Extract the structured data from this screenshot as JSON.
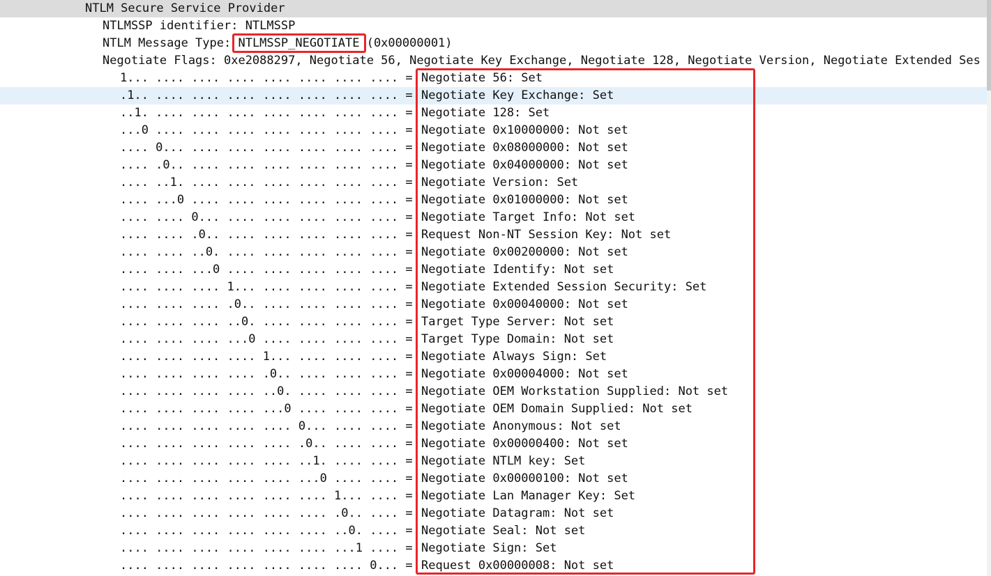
{
  "tree": {
    "ntlm_header": "NTLM Secure Service Provider",
    "identifier": "NTLMSSP identifier: NTLMSSP",
    "message_type_label": "NTLM Message Type: ",
    "message_type_value": "NTLMSSP_NEGOTIATE",
    "message_type_hex": " (0x00000001)",
    "flags_summary": "Negotiate Flags: 0xe2088297, Negotiate 56, Negotiate Key Exchange, Negotiate 128, Negotiate Version, Negotiate Extended Ses",
    "flags": [
      {
        "bits": "1... .... .... .... .... .... .... .... = ",
        "desc": "Negotiate 56: Set"
      },
      {
        "bits": ".1.. .... .... .... .... .... .... .... = ",
        "desc": "Negotiate Key Exchange: Set"
      },
      {
        "bits": "..1. .... .... .... .... .... .... .... = ",
        "desc": "Negotiate 128: Set"
      },
      {
        "bits": "...0 .... .... .... .... .... .... .... = ",
        "desc": "Negotiate 0x10000000: Not set"
      },
      {
        "bits": ".... 0... .... .... .... .... .... .... = ",
        "desc": "Negotiate 0x08000000: Not set"
      },
      {
        "bits": ".... .0.. .... .... .... .... .... .... = ",
        "desc": "Negotiate 0x04000000: Not set"
      },
      {
        "bits": ".... ..1. .... .... .... .... .... .... = ",
        "desc": "Negotiate Version: Set"
      },
      {
        "bits": ".... ...0 .... .... .... .... .... .... = ",
        "desc": "Negotiate 0x01000000: Not set"
      },
      {
        "bits": ".... .... 0... .... .... .... .... .... = ",
        "desc": "Negotiate Target Info: Not set"
      },
      {
        "bits": ".... .... .0.. .... .... .... .... .... = ",
        "desc": "Request Non-NT Session Key: Not set"
      },
      {
        "bits": ".... .... ..0. .... .... .... .... .... = ",
        "desc": "Negotiate 0x00200000: Not set"
      },
      {
        "bits": ".... .... ...0 .... .... .... .... .... = ",
        "desc": "Negotiate Identify: Not set"
      },
      {
        "bits": ".... .... .... 1... .... .... .... .... = ",
        "desc": "Negotiate Extended Session Security: Set"
      },
      {
        "bits": ".... .... .... .0.. .... .... .... .... = ",
        "desc": "Negotiate 0x00040000: Not set"
      },
      {
        "bits": ".... .... .... ..0. .... .... .... .... = ",
        "desc": "Target Type Server: Not set"
      },
      {
        "bits": ".... .... .... ...0 .... .... .... .... = ",
        "desc": "Target Type Domain: Not set"
      },
      {
        "bits": ".... .... .... .... 1... .... .... .... = ",
        "desc": "Negotiate Always Sign: Set"
      },
      {
        "bits": ".... .... .... .... .0.. .... .... .... = ",
        "desc": "Negotiate 0x00004000: Not set"
      },
      {
        "bits": ".... .... .... .... ..0. .... .... .... = ",
        "desc": "Negotiate OEM Workstation Supplied: Not set"
      },
      {
        "bits": ".... .... .... .... ...0 .... .... .... = ",
        "desc": "Negotiate OEM Domain Supplied: Not set"
      },
      {
        "bits": ".... .... .... .... .... 0... .... .... = ",
        "desc": "Negotiate Anonymous: Not set"
      },
      {
        "bits": ".... .... .... .... .... .0.. .... .... = ",
        "desc": "Negotiate 0x00000400: Not set"
      },
      {
        "bits": ".... .... .... .... .... ..1. .... .... = ",
        "desc": "Negotiate NTLM key: Set"
      },
      {
        "bits": ".... .... .... .... .... ...0 .... .... = ",
        "desc": "Negotiate 0x00000100: Not set"
      },
      {
        "bits": ".... .... .... .... .... .... 1... .... = ",
        "desc": "Negotiate Lan Manager Key: Set"
      },
      {
        "bits": ".... .... .... .... .... .... .0.. .... = ",
        "desc": "Negotiate Datagram: Not set"
      },
      {
        "bits": ".... .... .... .... .... .... ..0. .... = ",
        "desc": "Negotiate Seal: Not set"
      },
      {
        "bits": ".... .... .... .... .... .... ...1 .... = ",
        "desc": "Negotiate Sign: Set"
      },
      {
        "bits": ".... .... .... .... .... .... .... 0... = ",
        "desc": "Request 0x00000008: Not set"
      }
    ]
  },
  "colors": {
    "highlight_box": "#e8262a",
    "header_bg": "#dcdcdc",
    "selected_row_bg": "#e4f1fb"
  },
  "icons": {
    "expand": "chevron-down-icon"
  }
}
